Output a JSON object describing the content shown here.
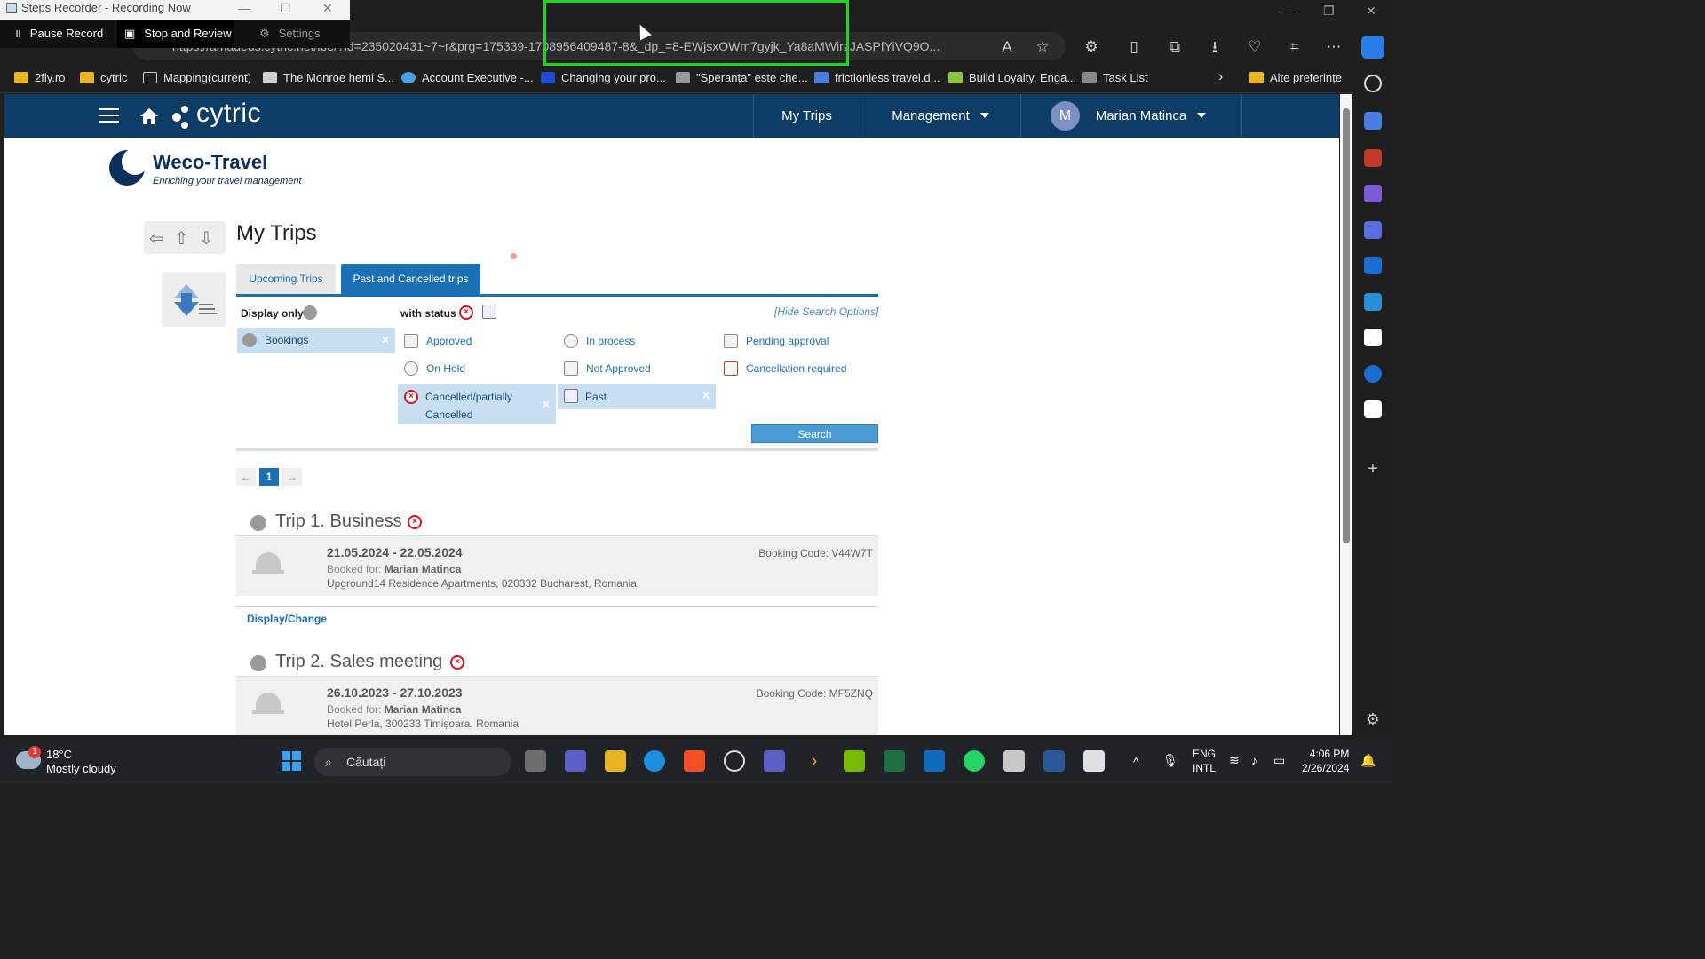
{
  "steps_recorder": {
    "title": "Steps Recorder - Recording Now",
    "pause": "Pause Record",
    "stop": "Stop and Review",
    "settings": "Settings"
  },
  "browser": {
    "url": "https://amadeus.cytric.net/ibe/?id=235020431~7~r&prg=175339-1708956409487-8&_dp_=8-EWjsxOWm7gyjk_Ya8aMWirzJASPfYiVQ9O...",
    "bookmarks": [
      {
        "label": "2fly.ro",
        "color": "#e8b422"
      },
      {
        "label": "cytric",
        "color": "#e8b422"
      },
      {
        "label": "Mapping(current)",
        "color": "#ffffff"
      },
      {
        "label": "The Monroe hemi S...",
        "color": "#cfcfcf"
      },
      {
        "label": "Account Executive -...",
        "color": "#4aa0e6"
      },
      {
        "label": "Changing your pro...",
        "color": "#1f4bd6"
      },
      {
        "label": "\"Speranța\" este che...",
        "color": "#999999"
      },
      {
        "label": "frictionless travel.d...",
        "color": "#4a7de0"
      },
      {
        "label": "Build Loyalty, Enga...",
        "color": "#8cc63f"
      },
      {
        "label": "Task List",
        "color": "#888888"
      }
    ],
    "other_favorites": "Alte preferințe"
  },
  "app": {
    "logo": "cytric",
    "nav": {
      "my_trips": "My Trips",
      "management": "Management",
      "user_initial": "M",
      "user_name": "Marian Matinca"
    },
    "brand": {
      "name": "Weco-Travel",
      "tagline": "Enriching your travel management"
    },
    "page_title": "My Trips",
    "tabs": {
      "upcoming": "Upcoming Trips",
      "past": "Past and Cancelled trips"
    },
    "filters": {
      "display_only": "Display only",
      "with_status": "with status",
      "hide_options": "[Hide Search Options]",
      "bookings": "Bookings",
      "approved": "Approved",
      "in_process": "In process",
      "pending_approval": "Pending approval",
      "on_hold": "On Hold",
      "not_approved": "Not Approved",
      "cancellation_required": "Cancellation required",
      "cancelled_line1": "Cancelled/partially",
      "cancelled_line2": "Cancelled",
      "past": "Past",
      "search": "Search"
    },
    "pager": {
      "prev": "←",
      "page": "1",
      "next": "→"
    },
    "trips": [
      {
        "title": "Trip 1. Business",
        "dates": "21.05.2024 - 22.05.2024",
        "booked_for_label": "Booked for:",
        "booked_for": "Marian Matinca",
        "address": "Upground14 Residence Apartments, 020332 Bucharest, Romania",
        "booking_code": "Booking Code: V44W7T",
        "link": "Display/Change"
      },
      {
        "title": "Trip 2. Sales meeting",
        "dates": "26.10.2023 - 27.10.2023",
        "booked_for_label": "Booked for:",
        "booked_for": "Marian Matinca",
        "address": "Hotel Perla, 300233 Timișoara, Romania",
        "booking_code": "Booking Code: MF5ZNQ"
      }
    ]
  },
  "taskbar": {
    "temp": "18°C",
    "weather": "Mostly cloudy",
    "search": "Căutați",
    "lang1": "ENG",
    "lang2": "INTL",
    "time": "4:06 PM",
    "date": "2/26/2024",
    "notif": "1"
  }
}
